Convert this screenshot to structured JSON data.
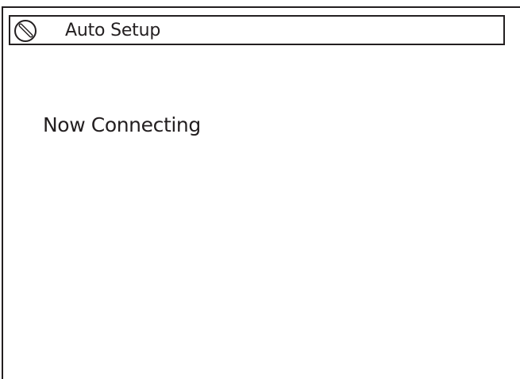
{
  "window": {
    "title": "Auto Setup",
    "icon": "prohibited-circle-icon"
  },
  "main": {
    "status_text": "Now Connecting"
  },
  "colors": {
    "line": "#231f20",
    "background": "#ffffff",
    "text": "#231f20"
  }
}
